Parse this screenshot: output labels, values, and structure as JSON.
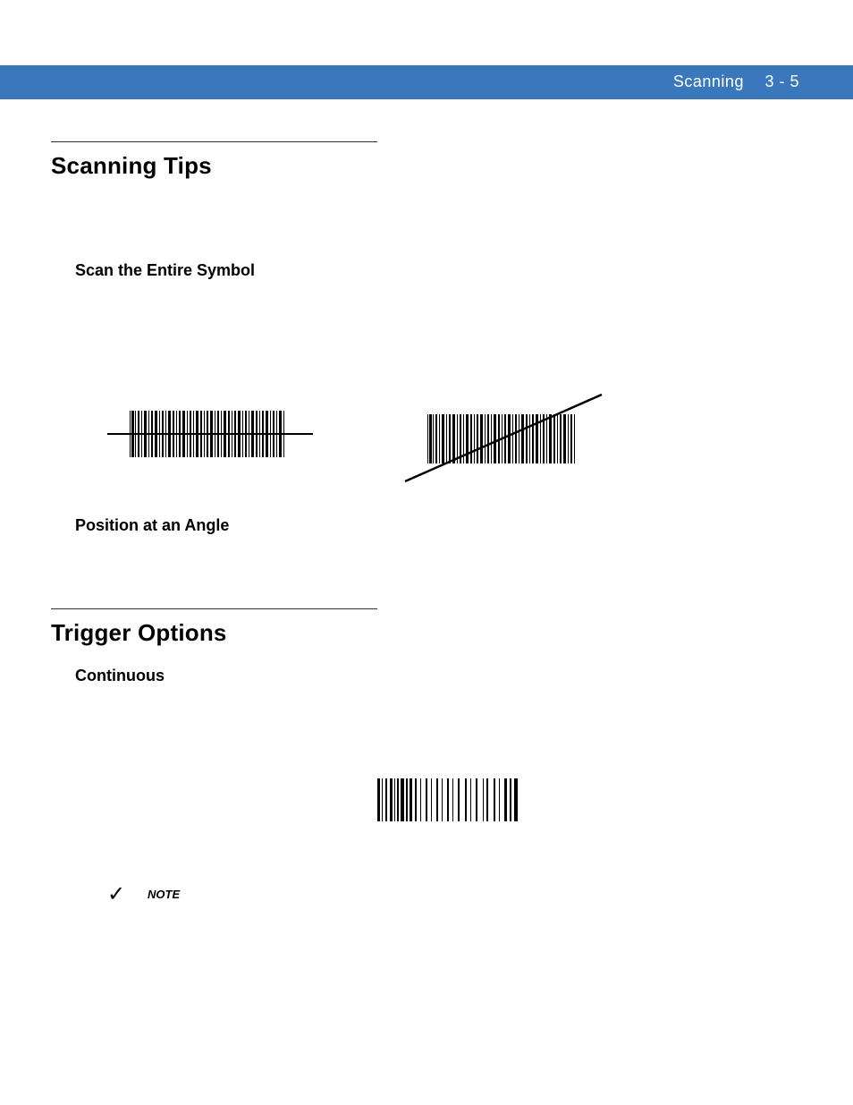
{
  "header": {
    "chapter": "Scanning",
    "page": "3 - 5"
  },
  "sections": {
    "scanning_tips": {
      "title": "Scanning Tips",
      "sub1": "Scan the Entire Symbol",
      "sub2": "Position at an Angle"
    },
    "trigger_options": {
      "title": "Trigger Options",
      "sub1": "Continuous"
    }
  },
  "note": {
    "check": "✓",
    "label": "NOTE"
  }
}
